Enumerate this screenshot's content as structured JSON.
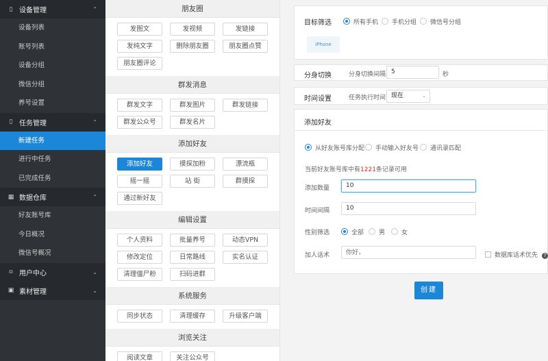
{
  "sidebar": {
    "groups": [
      {
        "title": "设备管理",
        "icon": "phone-icon",
        "glyph": "▯",
        "chevron": "⌃",
        "items": [
          "设备列表",
          "账号列表",
          "设备分组",
          "微信分组",
          "养号设置"
        ]
      },
      {
        "title": "任务管理",
        "icon": "phone-icon",
        "glyph": "▯",
        "chevron": "⌃",
        "items": [
          "新建任务",
          "进行中任务",
          "已完成任务"
        ]
      },
      {
        "title": "数据仓库",
        "icon": "grid-icon",
        "glyph": "▦",
        "chevron": "⌃",
        "items": [
          "好友账号库",
          "今日概况",
          "微信号概况"
        ]
      },
      {
        "title": "用户中心",
        "icon": "user-icon",
        "glyph": "⍝",
        "chevron": "⌄",
        "items": []
      },
      {
        "title": "素材管理",
        "icon": "folder-icon",
        "glyph": "▣",
        "chevron": "⌄",
        "items": []
      }
    ],
    "active_item": "新建任务"
  },
  "sections": [
    {
      "title": "朋友圈",
      "buttons": [
        "发图文",
        "发视频",
        "发链接",
        "发纯文字",
        "删除朋友圈",
        "朋友圈点赞",
        "朋友圈评论"
      ]
    },
    {
      "title": "群发消息",
      "buttons": [
        "群发文字",
        "群发图片",
        "群发链接",
        "群发公众号",
        "群发名片"
      ]
    },
    {
      "title": "添加好友",
      "buttons": [
        "添加好友",
        "摸探加粉",
        "漂流瓶",
        "摇一摇",
        "站 街",
        "群摸探",
        "通过新好友"
      ]
    },
    {
      "title": "编辑设置",
      "buttons": [
        "个人资料",
        "批量养号",
        "动态VPN",
        "修改定位",
        "日常路线",
        "实名认证",
        "清理僵尸粉",
        "扫码进群"
      ]
    },
    {
      "title": "系统服务",
      "buttons": [
        "同步状态",
        "清理缓存",
        "升级客户端"
      ]
    },
    {
      "title": "浏览关注",
      "buttons": [
        "阅读文章",
        "关注公众号"
      ]
    }
  ],
  "active_button": "添加好友",
  "target": {
    "label": "目标筛选",
    "options": [
      "所有手机",
      "手机分组",
      "微信号分组"
    ],
    "selected": "所有手机",
    "device_tag": "iPhone"
  },
  "switch": {
    "label": "分身切换",
    "interval_label": "分身切换间隔",
    "interval_value": "5",
    "unit": "秒"
  },
  "time_setting": {
    "label": "时间设置",
    "exec_label": "任务执行时间",
    "exec_value": "现在"
  },
  "add_friend": {
    "title": "添加好友",
    "source_options": [
      "从好友账号库分配",
      "手动输入好友号",
      "通讯录匹配"
    ],
    "selected_source": "从好友账号库分配",
    "records_prefix": "当前好友账号库中有",
    "records_count": "1221",
    "records_suffix": "条记录可用",
    "count_label": "添加数量",
    "count_value": "10",
    "interval_label": "时间间隔",
    "interval_value": "10",
    "gender_label": "性别筛选",
    "gender_options": [
      "全部",
      "男",
      "女"
    ],
    "gender_selected": "全部",
    "greeting_label": "加人话术",
    "greeting_placeholder": "你好，",
    "db_priority_label": "数据库话术优先",
    "help_glyph": "?"
  },
  "create_label": "创建",
  "colors": {
    "accent": "#1c86d8",
    "sidebar_bg": "#2f3337",
    "highlight": "#e2231a"
  }
}
